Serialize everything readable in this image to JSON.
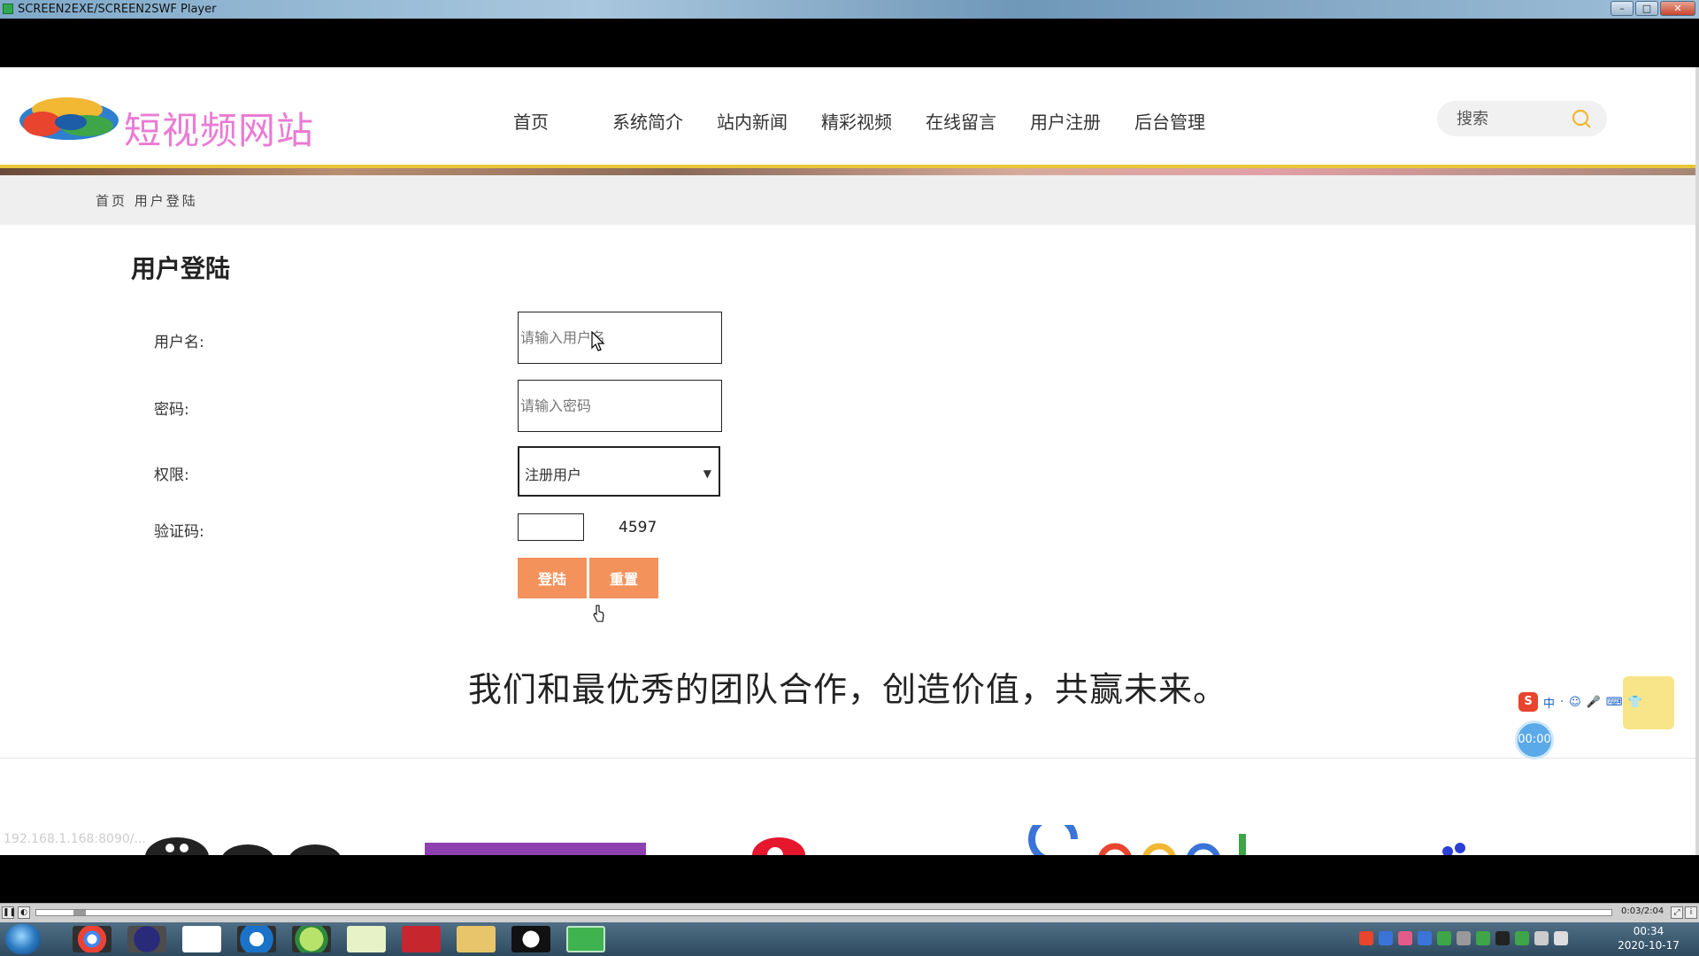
{
  "window": {
    "title": "SCREEN2EXE/SCREEN2SWF Player",
    "min": "–",
    "max": "□",
    "close": "✕"
  },
  "site": {
    "name": "短视频网站",
    "nav": [
      "首页",
      "系统简介",
      "站内新闻",
      "精彩视频",
      "在线留言",
      "用户注册",
      "后台管理"
    ],
    "search_placeholder": "搜索"
  },
  "breadcrumb": "首页 用户登陆",
  "login": {
    "title": "用户登陆",
    "username_label": "用户名:",
    "username_placeholder": "请输入用户名",
    "password_label": "密码:",
    "password_placeholder": "请输入密码",
    "role_label": "权限:",
    "role_value": "注册用户",
    "captcha_label": "验证码:",
    "captcha_code": "4597",
    "login_button": "登陆",
    "reset_button": "重置"
  },
  "slogan": "我们和最优秀的团队合作，创造价值，共赢未来。",
  "status_url": "192.168.1.168:8090/...",
  "ime": {
    "items": [
      "中",
      "·",
      "☺",
      "🎤",
      "⌨",
      "👕"
    ],
    "timer": "00:00"
  },
  "player": {
    "time": "0:03/2:04"
  },
  "taskbar": {
    "time": "00:34",
    "date": "2020-10-17"
  },
  "colors": {
    "accent_orange": "#f4925c",
    "site_name_pink": "#ea7bd4",
    "header_yellow": "#e8c73a"
  }
}
